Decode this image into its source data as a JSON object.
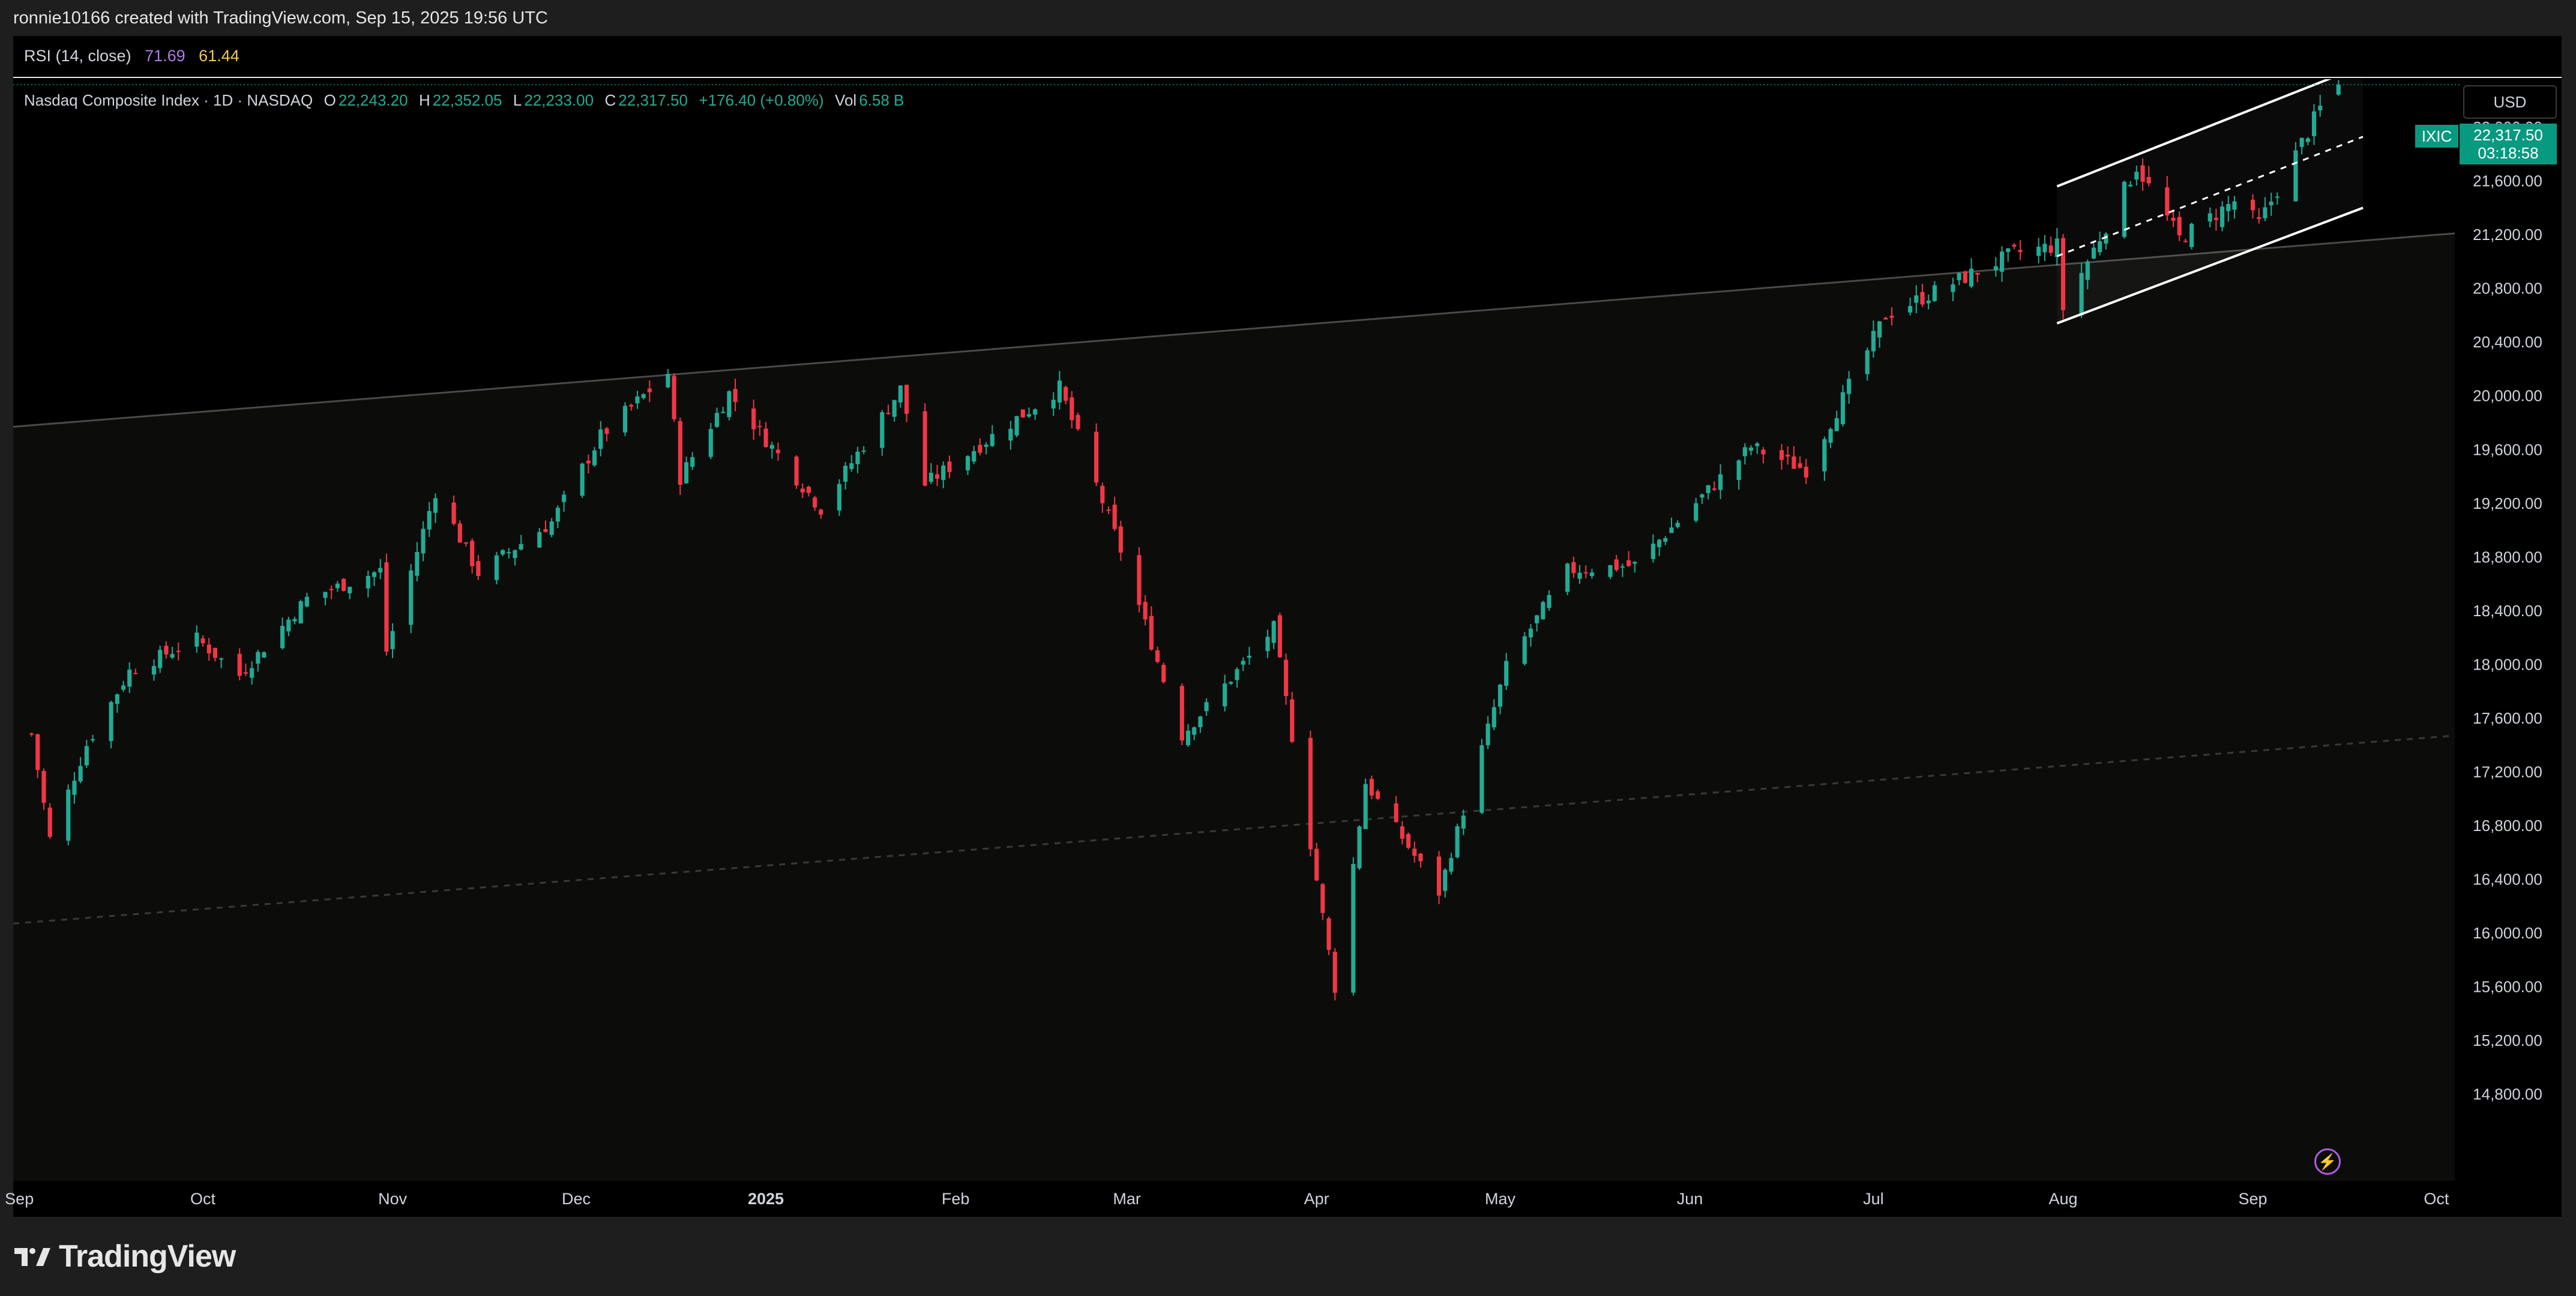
{
  "header": {
    "credit": "ronnie10166 created with TradingView.com, Sep 15, 2025 19:56 UTC"
  },
  "rsi": {
    "label": "RSI (14, close)",
    "value_1": "71.69",
    "value_2": "61.44",
    "color_1": "#b07ce8",
    "color_2": "#f2c94c"
  },
  "legend": {
    "title": "Nasdaq Composite Index · 1D · NASDAQ",
    "open_label": "O",
    "open": "22,243.20",
    "high_label": "H",
    "high": "22,352.05",
    "low_label": "L",
    "low": "22,233.00",
    "close_label": "C",
    "close": "22,317.50",
    "change": "+176.40 (+0.80%)",
    "vol_label": "Vol",
    "vol": "6.58 B"
  },
  "currency": "USD",
  "price_badge": {
    "symbol": "IXIC",
    "price": "22,317.50",
    "countdown": "03:18:58"
  },
  "brand": {
    "name": "TradingView",
    "icon": "tradingview-logo-icon"
  },
  "alert_icon": "lightning-icon",
  "colors": {
    "up": "#22ab94",
    "down": "#f23645",
    "background": "#000000",
    "channel": "#ffffff"
  },
  "chart_data": {
    "type": "candlestick",
    "symbol": "IXIC",
    "interval": "1D",
    "ylim": [
      14500,
      22700
    ],
    "y_ticks": [
      "14,800.00",
      "15,200.00",
      "15,600.00",
      "16,000.00",
      "16,400.00",
      "16,800.00",
      "17,200.00",
      "17,600.00",
      "18,000.00",
      "18,400.00",
      "18,800.00",
      "19,200.00",
      "19,600.00",
      "20,000.00",
      "20,400.00",
      "20,800.00",
      "21,200.00",
      "21,600.00",
      "22,000.00"
    ],
    "y_tick_values": [
      14800,
      15200,
      15600,
      16000,
      16400,
      16800,
      17200,
      17600,
      18000,
      18400,
      18800,
      19200,
      19600,
      20000,
      20400,
      20800,
      21200,
      21600,
      22000
    ],
    "x_ticks": [
      {
        "label": "Sep",
        "date": "2024-09-01"
      },
      {
        "label": "Oct",
        "date": "2024-10-01"
      },
      {
        "label": "Nov",
        "date": "2024-11-01"
      },
      {
        "label": "Dec",
        "date": "2024-12-01"
      },
      {
        "label": "2025",
        "date": "2025-01-01"
      },
      {
        "label": "Feb",
        "date": "2025-02-01"
      },
      {
        "label": "Mar",
        "date": "2025-03-01"
      },
      {
        "label": "Apr",
        "date": "2025-04-01"
      },
      {
        "label": "May",
        "date": "2025-05-01"
      },
      {
        "label": "Jun",
        "date": "2025-06-01"
      },
      {
        "label": "Jul",
        "date": "2025-07-01"
      },
      {
        "label": "Aug",
        "date": "2025-08-01"
      },
      {
        "label": "Sep",
        "date": "2025-09-01"
      },
      {
        "label": "Oct",
        "date": "2025-10-01"
      }
    ],
    "x_range": [
      "2024-08-31",
      "2025-10-04"
    ],
    "waypoints": [
      [
        "2024-09-03",
        17480
      ],
      [
        "2024-09-06",
        16700
      ],
      [
        "2024-09-12",
        17400
      ],
      [
        "2024-09-19",
        17950
      ],
      [
        "2024-09-30",
        18190
      ],
      [
        "2024-10-07",
        17920
      ],
      [
        "2024-10-18",
        18490
      ],
      [
        "2024-10-30",
        18700
      ],
      [
        "2024-10-31",
        18100
      ],
      [
        "2024-11-08",
        19290
      ],
      [
        "2024-11-15",
        18680
      ],
      [
        "2024-11-27",
        19060
      ],
      [
        "2024-12-05",
        19700
      ],
      [
        "2024-12-16",
        20170
      ],
      [
        "2024-12-18",
        19390
      ],
      [
        "2024-12-26",
        20020
      ],
      [
        "2025-01-10",
        19160
      ],
      [
        "2025-01-23",
        20050
      ],
      [
        "2025-01-27",
        19340
      ],
      [
        "2025-02-18",
        20060
      ],
      [
        "2025-02-28",
        18850
      ],
      [
        "2025-03-10",
        17470
      ],
      [
        "2025-03-25",
        18270
      ],
      [
        "2025-04-04",
        15590
      ],
      [
        "2025-04-09",
        17120
      ],
      [
        "2025-04-21",
        16300
      ],
      [
        "2025-05-02",
        17980
      ],
      [
        "2025-05-12",
        18700
      ],
      [
        "2025-05-23",
        18740
      ],
      [
        "2025-06-11",
        19620
      ],
      [
        "2025-06-20",
        19450
      ],
      [
        "2025-07-03",
        20600
      ],
      [
        "2025-07-24",
        21060
      ],
      [
        "2025-07-31",
        21120
      ],
      [
        "2025-08-01",
        20650
      ],
      [
        "2025-08-13",
        21710
      ],
      [
        "2025-08-20",
        21170
      ],
      [
        "2025-08-29",
        21450
      ],
      [
        "2025-09-02",
        21280
      ],
      [
        "2025-09-12",
        22140
      ],
      [
        "2025-09-15",
        22317.5
      ]
    ],
    "last_candle": {
      "date": "2025-09-15",
      "open": 22243.2,
      "high": 22352.05,
      "low": 22233.0,
      "close": 22317.5
    },
    "trendlines": [
      {
        "style": "solid",
        "points": [
          [
            "2024-08-31",
            19770
          ],
          [
            "2025-10-04",
            21210
          ]
        ]
      },
      {
        "style": "dashed",
        "points": [
          [
            "2024-08-31",
            16070
          ],
          [
            "2025-10-04",
            17470
          ]
        ]
      }
    ],
    "channel": {
      "upper": [
        [
          "2025-07-31",
          21560
        ],
        [
          "2025-09-19",
          22460
        ]
      ],
      "middle": [
        [
          "2025-07-31",
          21040
        ],
        [
          "2025-09-19",
          21930
        ]
      ],
      "lower": [
        [
          "2025-07-31",
          20540
        ],
        [
          "2025-09-19",
          21400
        ]
      ]
    },
    "title": "",
    "xlabel": "",
    "ylabel": "",
    "grid": false
  }
}
